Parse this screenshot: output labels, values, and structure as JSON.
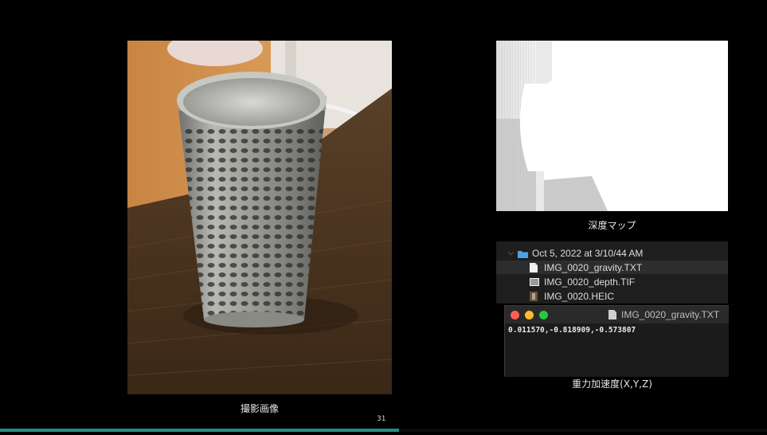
{
  "captions": {
    "photo": "撮影画像",
    "depth": "深度マップ",
    "gravity": "重力加速度(X,Y,Z)"
  },
  "finder": {
    "folder": "Oct 5, 2022 at 3/10/44 AM",
    "files": [
      "IMG_0020_gravity.TXT",
      "IMG_0020_depth.TIF",
      "IMG_0020.HEIC"
    ]
  },
  "textedit": {
    "title": "IMG_0020_gravity.TXT",
    "content": "0.011570,-0.818909,-0.573807"
  },
  "slide": {
    "page_number": "31",
    "progress_fraction": 0.52
  },
  "colors": {
    "accent": "#1f8f86",
    "folder": "#4aa3e8",
    "close": "#ff5f57",
    "minimize": "#febc2e",
    "zoom": "#28c840"
  }
}
